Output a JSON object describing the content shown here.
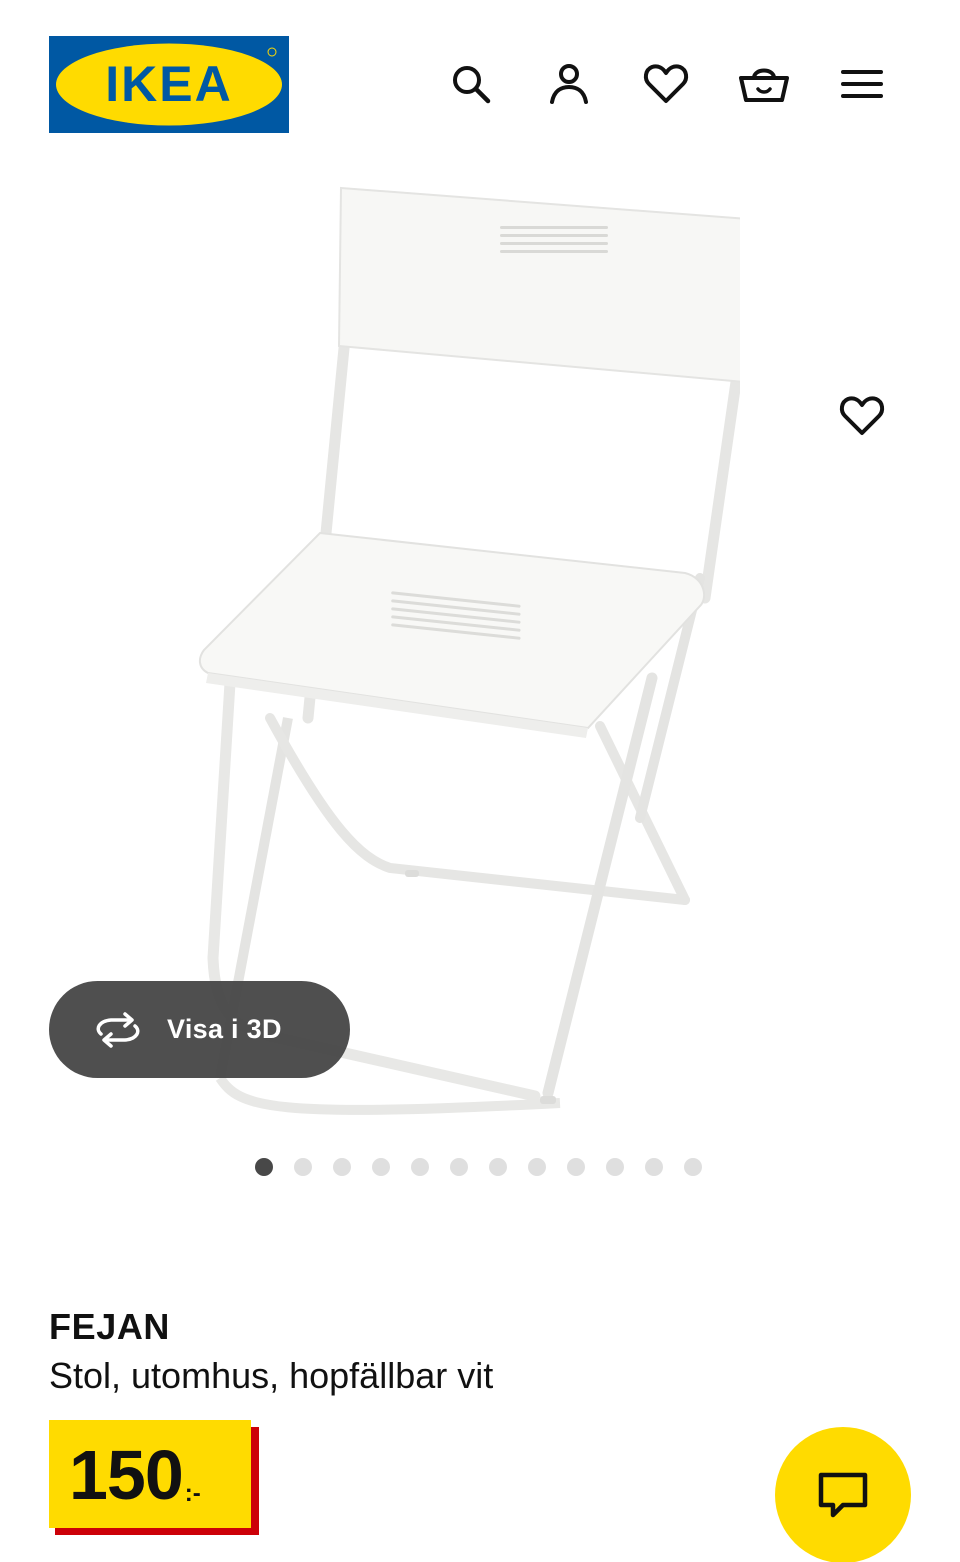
{
  "header": {
    "logo_text": "IKEA",
    "icons": [
      "search-icon",
      "account-icon",
      "heart-icon",
      "basket-icon",
      "menu-icon"
    ]
  },
  "gallery": {
    "favorite_icon": "heart-icon",
    "view_3d_label": "Visa i 3D",
    "view_3d_icon": "rotate-3d-icon",
    "image_count": 12,
    "active_image_index": 0
  },
  "product": {
    "name": "FEJAN",
    "description": "Stol, utomhus, hopfällbar vit",
    "price_integer": "150",
    "price_suffix": ":-"
  },
  "chat": {
    "icon": "chat-icon"
  },
  "colors": {
    "brand_blue": "#0058a3",
    "brand_yellow": "#ffdb00",
    "price_red": "#cc0008",
    "pill_dark": "#484848"
  }
}
